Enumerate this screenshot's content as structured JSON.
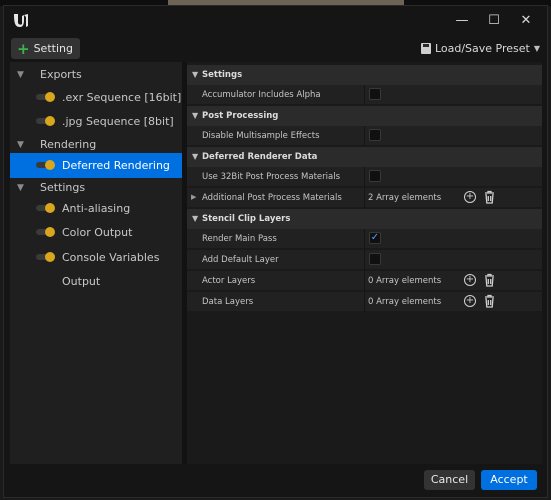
{
  "window": {
    "controls": [
      "minimize",
      "maximize",
      "close"
    ]
  },
  "toolbar": {
    "setting_label": "Setting",
    "preset_label": "Load/Save Preset"
  },
  "sidebar": {
    "categories": [
      {
        "label": "Exports",
        "items": [
          ".exr Sequence [16bit]",
          ".jpg Sequence [8bit]"
        ]
      },
      {
        "label": "Rendering",
        "items": [
          "Deferred Rendering"
        ]
      },
      {
        "label": "Settings",
        "items": [
          "Anti-aliasing",
          "Color Output",
          "Console Variables",
          "Output"
        ]
      }
    ],
    "selected": "Deferred Rendering"
  },
  "details": {
    "sections": [
      {
        "title": "Settings",
        "rows": [
          {
            "label": "Accumulator Includes Alpha",
            "type": "checkbox",
            "checked": false
          }
        ]
      },
      {
        "title": "Post Processing",
        "rows": [
          {
            "label": "Disable Multisample Effects",
            "type": "checkbox",
            "checked": false
          }
        ]
      },
      {
        "title": "Deferred Renderer Data",
        "rows": [
          {
            "label": "Use 32Bit Post Process Materials",
            "type": "checkbox",
            "checked": false
          },
          {
            "label": "Additional Post Process Materials",
            "type": "array",
            "value": "2 Array elements"
          }
        ]
      },
      {
        "title": "Stencil Clip Layers",
        "rows": [
          {
            "label": "Render Main Pass",
            "type": "checkbox",
            "checked": true
          },
          {
            "label": "Add Default Layer",
            "type": "checkbox",
            "checked": false
          },
          {
            "label": "Actor Layers",
            "type": "array",
            "value": "0 Array elements"
          },
          {
            "label": "Data Layers",
            "type": "array",
            "value": "0 Array elements"
          }
        ]
      }
    ]
  },
  "footer": {
    "cancel_label": "Cancel",
    "accept_label": "Accept"
  },
  "colors": {
    "accent": "#0070e0",
    "toggle_on": "#d9a61e",
    "add_green": "#39b54a"
  }
}
